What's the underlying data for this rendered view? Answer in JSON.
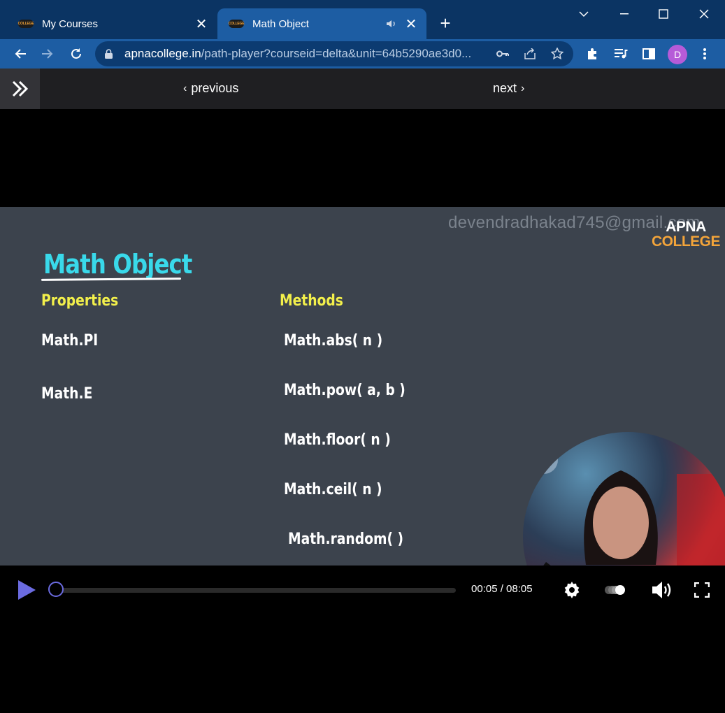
{
  "browser": {
    "tabs": [
      {
        "title": "My Courses",
        "favicon": "COLLEGE"
      },
      {
        "title": "Math Object",
        "favicon": "COLLEGE"
      }
    ],
    "url_domain": "apnacollege.in",
    "url_path": "/path-player?courseid=delta&unit=64b5290ae3d0...",
    "profile_initial": "D"
  },
  "nav": {
    "previous_label": "previous",
    "next_label": "next"
  },
  "slide": {
    "watermark": "devendradhakad745@gmail.com",
    "logo_line1": "APNA",
    "logo_line2": "COLLEGE",
    "title": "Math Object",
    "properties_heading": "Properties",
    "methods_heading": "Methods",
    "properties": [
      "Math.PI",
      "Math.E"
    ],
    "methods": [
      "Math.abs( n )",
      "Math.pow( a, b )",
      "Math.floor( n )",
      "Math.ceil( n )",
      "Math.random( )"
    ]
  },
  "player": {
    "time": "00:05 / 08:05",
    "progress_fraction": 0.0103,
    "accent_color": "#6b6be0"
  }
}
